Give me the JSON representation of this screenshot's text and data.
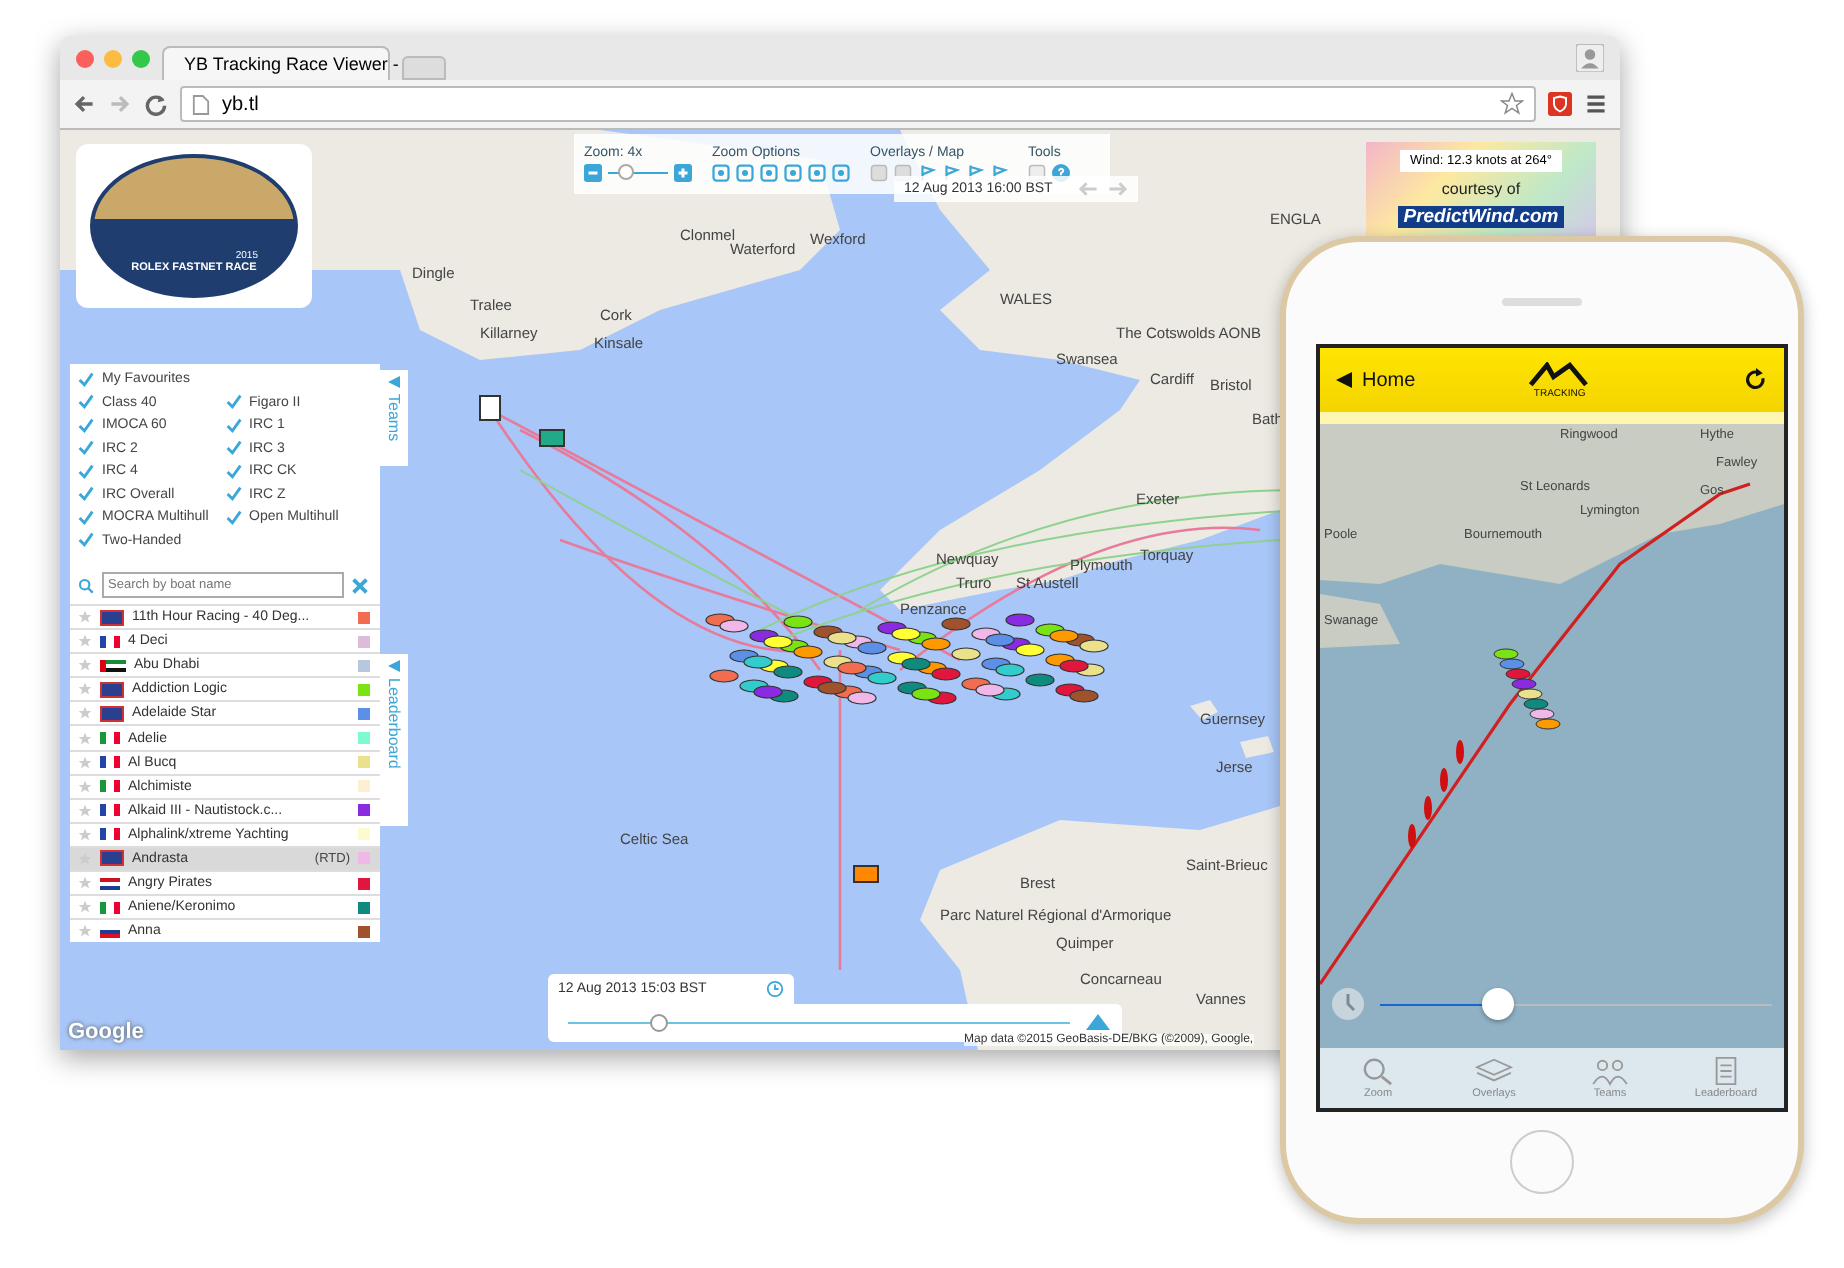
{
  "browser": {
    "tab_title": "YB Tracking Race Viewer -",
    "url": "yb.tl"
  },
  "logo": {
    "year": "2015",
    "name": "ROLEX FASTNET RACE"
  },
  "classes": [
    {
      "label": "My Favourites",
      "checked": true
    },
    {
      "label": "Class 40",
      "checked": true
    },
    {
      "label": "Figaro II",
      "checked": true
    },
    {
      "label": "IMOCA 60",
      "checked": true
    },
    {
      "label": "IRC 1",
      "checked": true
    },
    {
      "label": "IRC 2",
      "checked": true
    },
    {
      "label": "IRC 3",
      "checked": true
    },
    {
      "label": "IRC 4",
      "checked": true
    },
    {
      "label": "IRC CK",
      "checked": true
    },
    {
      "label": "IRC Overall",
      "checked": true
    },
    {
      "label": "IRC Z",
      "checked": true
    },
    {
      "label": "MOCRA Multihull",
      "checked": true
    },
    {
      "label": "Open Multihull",
      "checked": true
    },
    {
      "label": "Two-Handed",
      "checked": true
    }
  ],
  "search": {
    "placeholder": "Search by boat name"
  },
  "boats": [
    {
      "name": "11th Hour Racing - 40 Deg...",
      "color": "#f26c4f",
      "selected": false
    },
    {
      "name": "4 Deci",
      "color": "#dcbcd9",
      "selected": false
    },
    {
      "name": "Abu Dhabi",
      "color": "#b7c7e0",
      "selected": false
    },
    {
      "name": "Addiction Logic",
      "color": "#7ae314",
      "selected": false
    },
    {
      "name": "Adelaide Star",
      "color": "#5c8fe6",
      "selected": false
    },
    {
      "name": "Adelie",
      "color": "#7dfad0",
      "selected": false
    },
    {
      "name": "Al Bucq",
      "color": "#ebe08c",
      "selected": false
    },
    {
      "name": "Alchimiste",
      "color": "#fdf0d2",
      "selected": false
    },
    {
      "name": "Alkaid III - Nautistock.c...",
      "color": "#8a2be2",
      "selected": false
    },
    {
      "name": "Alphalink/xtreme Yachting",
      "color": "#fbfbcf",
      "selected": false
    },
    {
      "name": "Andrasta",
      "color": "#f0b8e8",
      "selected": true,
      "status": "(RTD)"
    },
    {
      "name": "Angry Pirates",
      "color": "#e0163c",
      "selected": false
    },
    {
      "name": "Aniene/Keronimo",
      "color": "#0f8a7e",
      "selected": false
    },
    {
      "name": "Anna",
      "color": "#a0522d",
      "selected": false
    }
  ],
  "side_tabs": [
    {
      "label": "Teams"
    },
    {
      "label": "Leaderboard"
    }
  ],
  "toolbar": {
    "zoom_label": "Zoom: 4x",
    "zoom_slider": {
      "level": 0.3
    },
    "zoom_options": "Zoom Options",
    "overlays": "Overlays / Map",
    "tools": "Tools",
    "time": "12 Aug 2013 16:00 BST"
  },
  "wind": {
    "reading": "Wind: 12.3 knots at 264°",
    "courtesy": "courtesy of",
    "brand": "PredictWind.com"
  },
  "timeline": {
    "time": "12 Aug 2013 15:03 BST",
    "level": 0.18
  },
  "map_labels": [
    "Dingle",
    "Tralee",
    "Killarney",
    "Cork",
    "Kinsale",
    "Clonmel",
    "Waterford",
    "Wexford",
    "ENGLA",
    "WALES",
    "The Cotswolds AONB",
    "Swansea",
    "Cardiff",
    "Bristol",
    "Bath",
    "Exeter",
    "Newquay",
    "Plymouth",
    "Torquay",
    "Truro",
    "St Austell",
    "Penzance",
    "Guernsey",
    "Jerse",
    "Celtic Sea",
    "Brest",
    "Saint-Brieuc",
    "Parc Naturel Régional d'Armorique",
    "Quimper",
    "Concarneau",
    "Vannes"
  ],
  "google": "Google",
  "attribution": "Map data ©2015 GeoBasis-DE/BKG (©2009), Google,",
  "phone": {
    "back": "Home",
    "logo_caption": "TRACKING",
    "map_labels": [
      "Ringwood",
      "Hythe",
      "Fawley",
      "St Leonards",
      "Gos",
      "Lymington",
      "Poole",
      "Bournemouth",
      "Swanage"
    ],
    "level": 0.3,
    "tabs": [
      {
        "label": "Zoom"
      },
      {
        "label": "Overlays"
      },
      {
        "label": "Teams"
      },
      {
        "label": "Leaderboard"
      }
    ]
  }
}
